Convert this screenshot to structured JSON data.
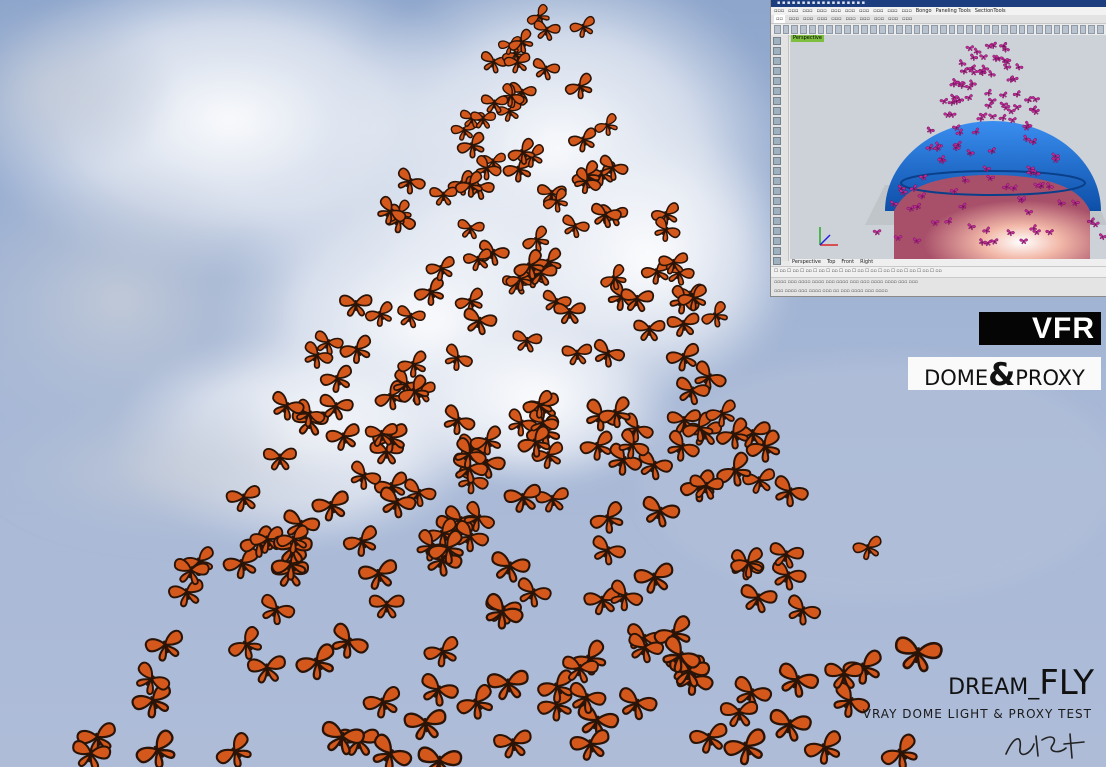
{
  "overlay": {
    "vfr_label": "VFR",
    "dome_word": "DOME",
    "amp": "&",
    "proxy_word": "PROXY",
    "dream_prefix": "DREAM_",
    "dream_fly": "FLY",
    "subtitle": "VRAY DOME LIGHT & PROXY TEST"
  },
  "inset": {
    "viewport_label": "Perspective",
    "viewport_tabs": [
      "Perspective",
      "Top",
      "Front",
      "Right"
    ],
    "menu_extras": [
      "Bongo",
      "Paneling Tools",
      "SectionTools"
    ]
  },
  "colors": {
    "sky": "#9fb2d2",
    "butterfly_orange": "#d4581c",
    "butterfly_dark": "#2a1408",
    "dome_blue": "#1b6fd6",
    "proxy_magenta": "#c22a9a"
  },
  "icons": [
    "butterfly-icon",
    "signature-mark"
  ]
}
